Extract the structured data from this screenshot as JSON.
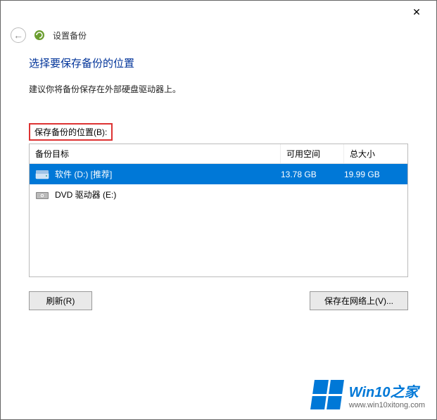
{
  "window": {
    "app_title": "设置备份"
  },
  "page": {
    "title": "选择要保存备份的位置",
    "hint": "建议你将备份保存在外部硬盘驱动器上。"
  },
  "section": {
    "label": "保存备份的位置(B):"
  },
  "table": {
    "header": {
      "target": "备份目标",
      "free": "可用空间",
      "total": "总大小"
    },
    "rows": [
      {
        "name": "软件 (D:) [推荐]",
        "free": "13.78 GB",
        "total": "19.99 GB",
        "selected": true,
        "icon": "hdd"
      },
      {
        "name": "DVD 驱动器 (E:)",
        "free": "",
        "total": "",
        "selected": false,
        "icon": "dvd"
      }
    ]
  },
  "buttons": {
    "refresh": "刷新(R)",
    "network": "保存在网络上(V)..."
  },
  "watermark": {
    "title": "Win10之家",
    "url": "www.win10xitong.com"
  }
}
